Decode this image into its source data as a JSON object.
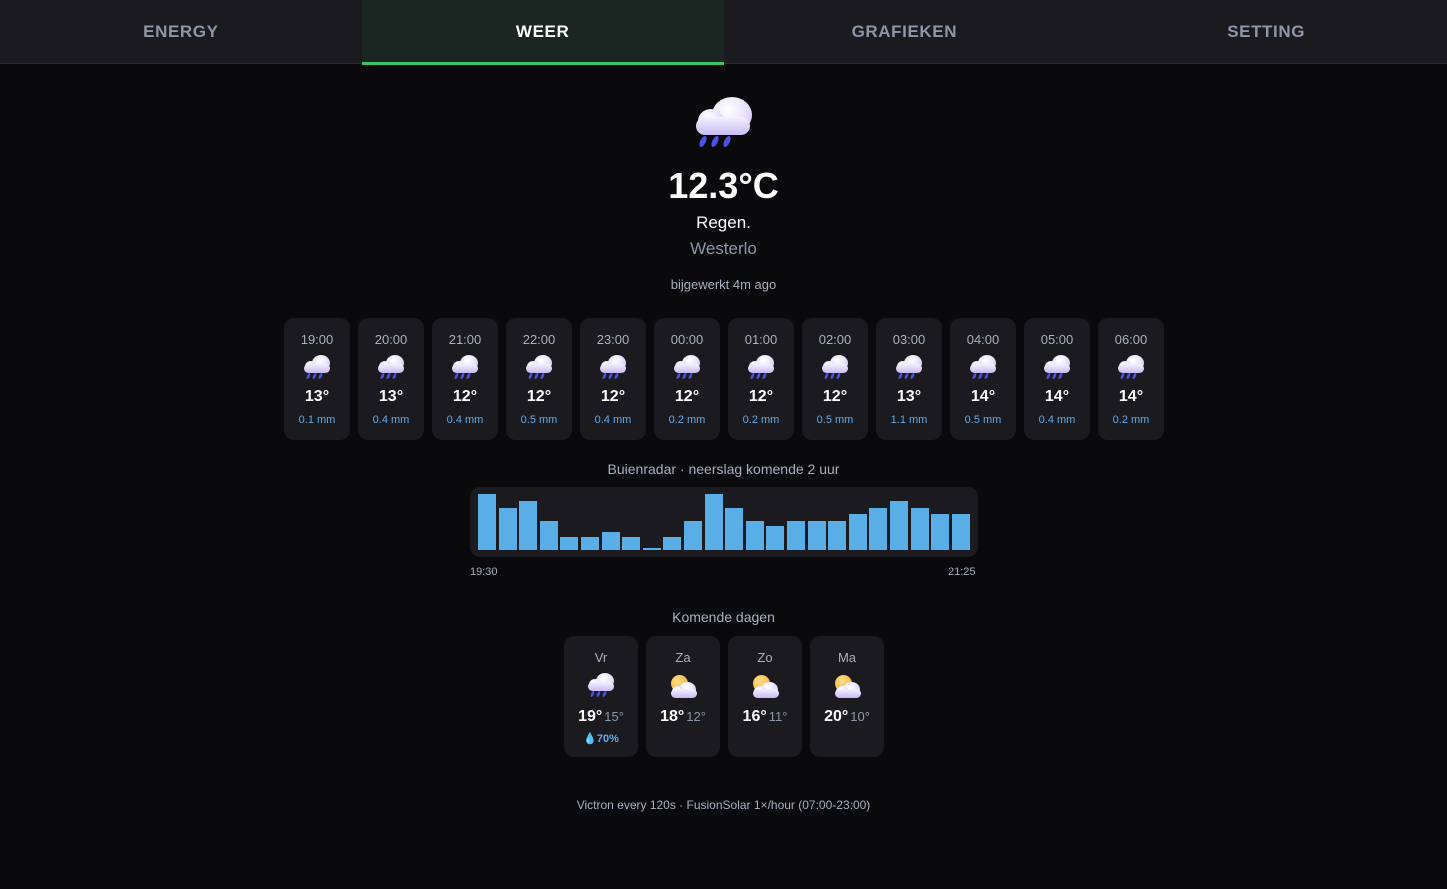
{
  "tabs": [
    {
      "label": "ENERGY"
    },
    {
      "label": "WEER"
    },
    {
      "label": "GRAFIEKEN"
    },
    {
      "label": "SETTING"
    }
  ],
  "active_tab": "WEER",
  "current": {
    "icon": "rain-cloud-icon",
    "temperature": "12.3°C",
    "condition": "Regen.",
    "location": "Westerlo",
    "updated": "bijgewerkt 4m ago"
  },
  "hourly": [
    {
      "time": "19:00",
      "icon": "rain-cloud-icon",
      "temp": "13°",
      "precip": "0.1 mm"
    },
    {
      "time": "20:00",
      "icon": "rain-cloud-icon",
      "temp": "13°",
      "precip": "0.4 mm"
    },
    {
      "time": "21:00",
      "icon": "rain-cloud-icon",
      "temp": "12°",
      "precip": "0.4 mm"
    },
    {
      "time": "22:00",
      "icon": "rain-cloud-icon",
      "temp": "12°",
      "precip": "0.5 mm"
    },
    {
      "time": "23:00",
      "icon": "rain-cloud-icon",
      "temp": "12°",
      "precip": "0.4 mm"
    },
    {
      "time": "00:00",
      "icon": "rain-cloud-icon",
      "temp": "12°",
      "precip": "0.2 mm"
    },
    {
      "time": "01:00",
      "icon": "rain-cloud-icon",
      "temp": "12°",
      "precip": "0.2 mm"
    },
    {
      "time": "02:00",
      "icon": "rain-cloud-icon",
      "temp": "12°",
      "precip": "0.5 mm"
    },
    {
      "time": "03:00",
      "icon": "rain-cloud-icon",
      "temp": "13°",
      "precip": "1.1 mm"
    },
    {
      "time": "04:00",
      "icon": "rain-cloud-icon",
      "temp": "14°",
      "precip": "0.5 mm"
    },
    {
      "time": "05:00",
      "icon": "rain-cloud-icon",
      "temp": "14°",
      "precip": "0.4 mm"
    },
    {
      "time": "06:00",
      "icon": "rain-cloud-icon",
      "temp": "14°",
      "precip": "0.2 mm"
    }
  ],
  "radar": {
    "title": "Buienradar · neerslag komende 2 uur",
    "start_label": "19:30",
    "end_label": "21:25",
    "intensity": [
      0.8,
      0.6,
      0.7,
      0.42,
      0.18,
      0.18,
      0.26,
      0.18,
      0.03,
      0.18,
      0.42,
      0.8,
      0.6,
      0.42,
      0.34,
      0.42,
      0.42,
      0.42,
      0.52,
      0.6,
      0.7,
      0.6,
      0.52,
      0.52
    ],
    "max_intensity": 0.8,
    "bar_color": "#5aaee6"
  },
  "daily": {
    "title": "Komende dagen",
    "days": [
      {
        "name": "Vr",
        "icon": "rain-cloud-icon",
        "high": "19°",
        "low": "15°",
        "precip_prob": "70%"
      },
      {
        "name": "Za",
        "icon": "partly-cloudy-icon",
        "high": "18°",
        "low": "12°",
        "precip_prob": ""
      },
      {
        "name": "Zo",
        "icon": "partly-cloudy-icon",
        "high": "16°",
        "low": "11°",
        "precip_prob": ""
      },
      {
        "name": "Ma",
        "icon": "partly-cloudy-icon",
        "high": "20°",
        "low": "10°",
        "precip_prob": ""
      }
    ]
  },
  "footer": "Victron every 120s · FusionSolar 1×/hour (07:00-23:00)",
  "colors": {
    "accent": "#3ac46e",
    "precip_text": "#5fa9e8",
    "rain_drop": "#4a52e6"
  }
}
